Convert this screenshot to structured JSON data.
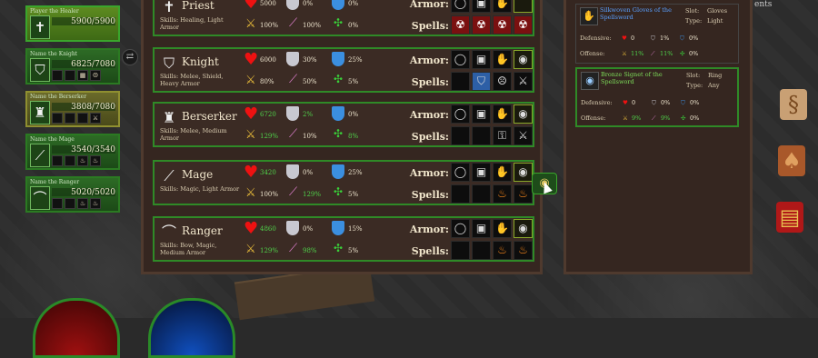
{
  "party": [
    {
      "name": "Player the Healer",
      "icon": "cross-icon",
      "glyph": "✝",
      "hp": "5900/5900",
      "slots": []
    },
    {
      "name": "Name the Knight",
      "icon": "shield-icon",
      "glyph": "⛉",
      "hp": "6825/7080",
      "slots": [
        "",
        "",
        "▦",
        "☹"
      ]
    },
    {
      "name": "Name the Berserker",
      "icon": "helmet-icon",
      "glyph": "♜",
      "hp": "3808/7080",
      "slots": [
        "",
        "",
        "",
        "⚔"
      ]
    },
    {
      "name": "Name the Mage",
      "icon": "staff-icon",
      "glyph": "⟋",
      "hp": "3540/3540",
      "slots": [
        "",
        "",
        "♨",
        "♨"
      ]
    },
    {
      "name": "Name the Ranger",
      "icon": "bow-icon",
      "glyph": "⌒",
      "hp": "5020/5020",
      "slots": [
        "",
        "",
        "♨",
        "♨"
      ]
    }
  ],
  "labels": {
    "armor": "Armor:",
    "spells": "Spells:"
  },
  "characters": [
    {
      "name": "Priest",
      "glyph": "✝",
      "skills": "Skills: Healing, Light Armor",
      "hp": "5000",
      "hp_green": false,
      "def": "0%",
      "def_green": false,
      "mdef": "0%",
      "off": "100%",
      "off_green": false,
      "moff": "100%",
      "moff_green": false,
      "crit": "0%",
      "crit_green": false,
      "armor": [
        "◯",
        "▣",
        "✋",
        ""
      ],
      "spells": [
        "☢",
        "☢",
        "☢",
        "☢"
      ]
    },
    {
      "name": "Knight",
      "glyph": "⛉",
      "skills": "Skills: Melee, Shield, Heavy Armor",
      "hp": "6000",
      "hp_green": false,
      "def": "30%",
      "def_green": false,
      "mdef": "25%",
      "off": "80%",
      "off_green": false,
      "moff": "50%",
      "moff_green": false,
      "crit": "5%",
      "crit_green": false,
      "armor": [
        "◯",
        "▣",
        "✋",
        "◉"
      ],
      "spells": [
        "",
        "⛉",
        "☹",
        "⚔"
      ]
    },
    {
      "name": "Berserker",
      "glyph": "♜",
      "skills": "Skills: Melee, Medium Armor",
      "hp": "6720",
      "hp_green": true,
      "def": "2%",
      "def_green": true,
      "mdef": "0%",
      "off": "129%",
      "off_green": true,
      "moff": "10%",
      "moff_green": false,
      "crit": "8%",
      "crit_green": true,
      "armor": [
        "◯",
        "▣",
        "✋",
        "◉"
      ],
      "spells": [
        "",
        "",
        "⚿",
        "⚔"
      ]
    },
    {
      "name": "Mage",
      "glyph": "⟋",
      "skills": "Skills: Magic, Light Armor",
      "hp": "3420",
      "hp_green": true,
      "def": "0%",
      "def_green": false,
      "mdef": "25%",
      "off": "100%",
      "off_green": false,
      "moff": "129%",
      "moff_green": true,
      "crit": "5%",
      "crit_green": false,
      "armor": [
        "◯",
        "▣",
        "✋",
        "◉"
      ],
      "spells": [
        "",
        "",
        "♨",
        "♨"
      ]
    },
    {
      "name": "Ranger",
      "glyph": "⌒",
      "skills": "Skills: Bow, Magic, Medium Armor",
      "hp": "4860",
      "hp_green": true,
      "def": "0%",
      "def_green": false,
      "mdef": "15%",
      "off": "129%",
      "off_green": true,
      "moff": "98%",
      "moff_green": true,
      "crit": "5%",
      "crit_green": false,
      "armor": [
        "◯",
        "▣",
        "✋",
        "◉"
      ],
      "spells": [
        "",
        "",
        "♨",
        "♨"
      ]
    }
  ],
  "items": [
    {
      "name": "Silkwoven Gloves of the Spellsword",
      "name_color": "blue",
      "slot_label": "Slot:",
      "slot": "Gloves",
      "type_label": "Type:",
      "type": "Light",
      "def_label": "Defensive:",
      "hp": "0",
      "def": "1%",
      "mdef": "0%",
      "off_label": "Offense:",
      "off": "11%",
      "moff": "11%",
      "crit": "0%"
    },
    {
      "name": "Bronze Signet of the Spellsword",
      "name_color": "green",
      "slot_label": "Slot:",
      "slot": "Ring",
      "type_label": "Type:",
      "type": "Any",
      "def_label": "Defensive:",
      "hp": "0",
      "def": "0%",
      "mdef": "0%",
      "off_label": "Offense:",
      "off": "9%",
      "moff": "9%",
      "crit": "0%"
    }
  ],
  "corner_text": "ents"
}
